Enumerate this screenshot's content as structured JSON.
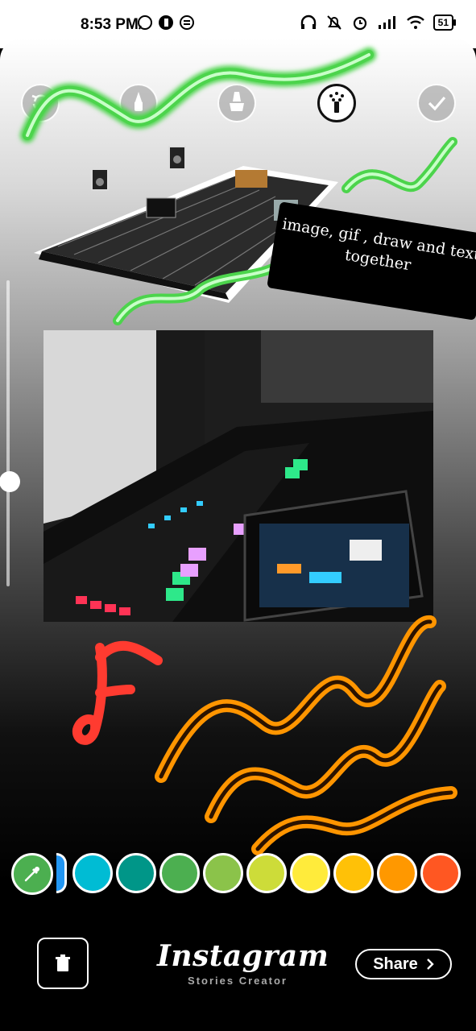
{
  "status_bar": {
    "time": "8:53 PM",
    "battery": "51",
    "left_icons": [
      "whatsapp-icon",
      "app-icon",
      "sync-icon"
    ],
    "right_icons": [
      "headphones-icon",
      "mute-icon",
      "alarm-icon",
      "signal-icon",
      "wifi-icon",
      "battery-icon"
    ]
  },
  "toolbar": {
    "tools": [
      "undo-icon",
      "marker-icon",
      "highlighter-icon",
      "neon-brush-icon",
      "done-icon"
    ],
    "active_tool": "neon-brush-icon"
  },
  "canvas": {
    "text_sticker": "image, gif , draw and text together",
    "stroke_colors": {
      "green": "#4cd44c",
      "orange": "#ff9500",
      "red": "#ff3b30"
    }
  },
  "palette": {
    "colors": [
      "#2196f3",
      "#00bcd4",
      "#009688",
      "#4caf50",
      "#8bc34a",
      "#cddc39",
      "#ffeb3b",
      "#ffc107",
      "#ff9800",
      "#ff5722"
    ],
    "eyedropper_color": "#4caf50"
  },
  "bottom_bar": {
    "brand_title": "Instagram",
    "brand_subtitle": "Stories Creator",
    "share_label": "Share"
  }
}
